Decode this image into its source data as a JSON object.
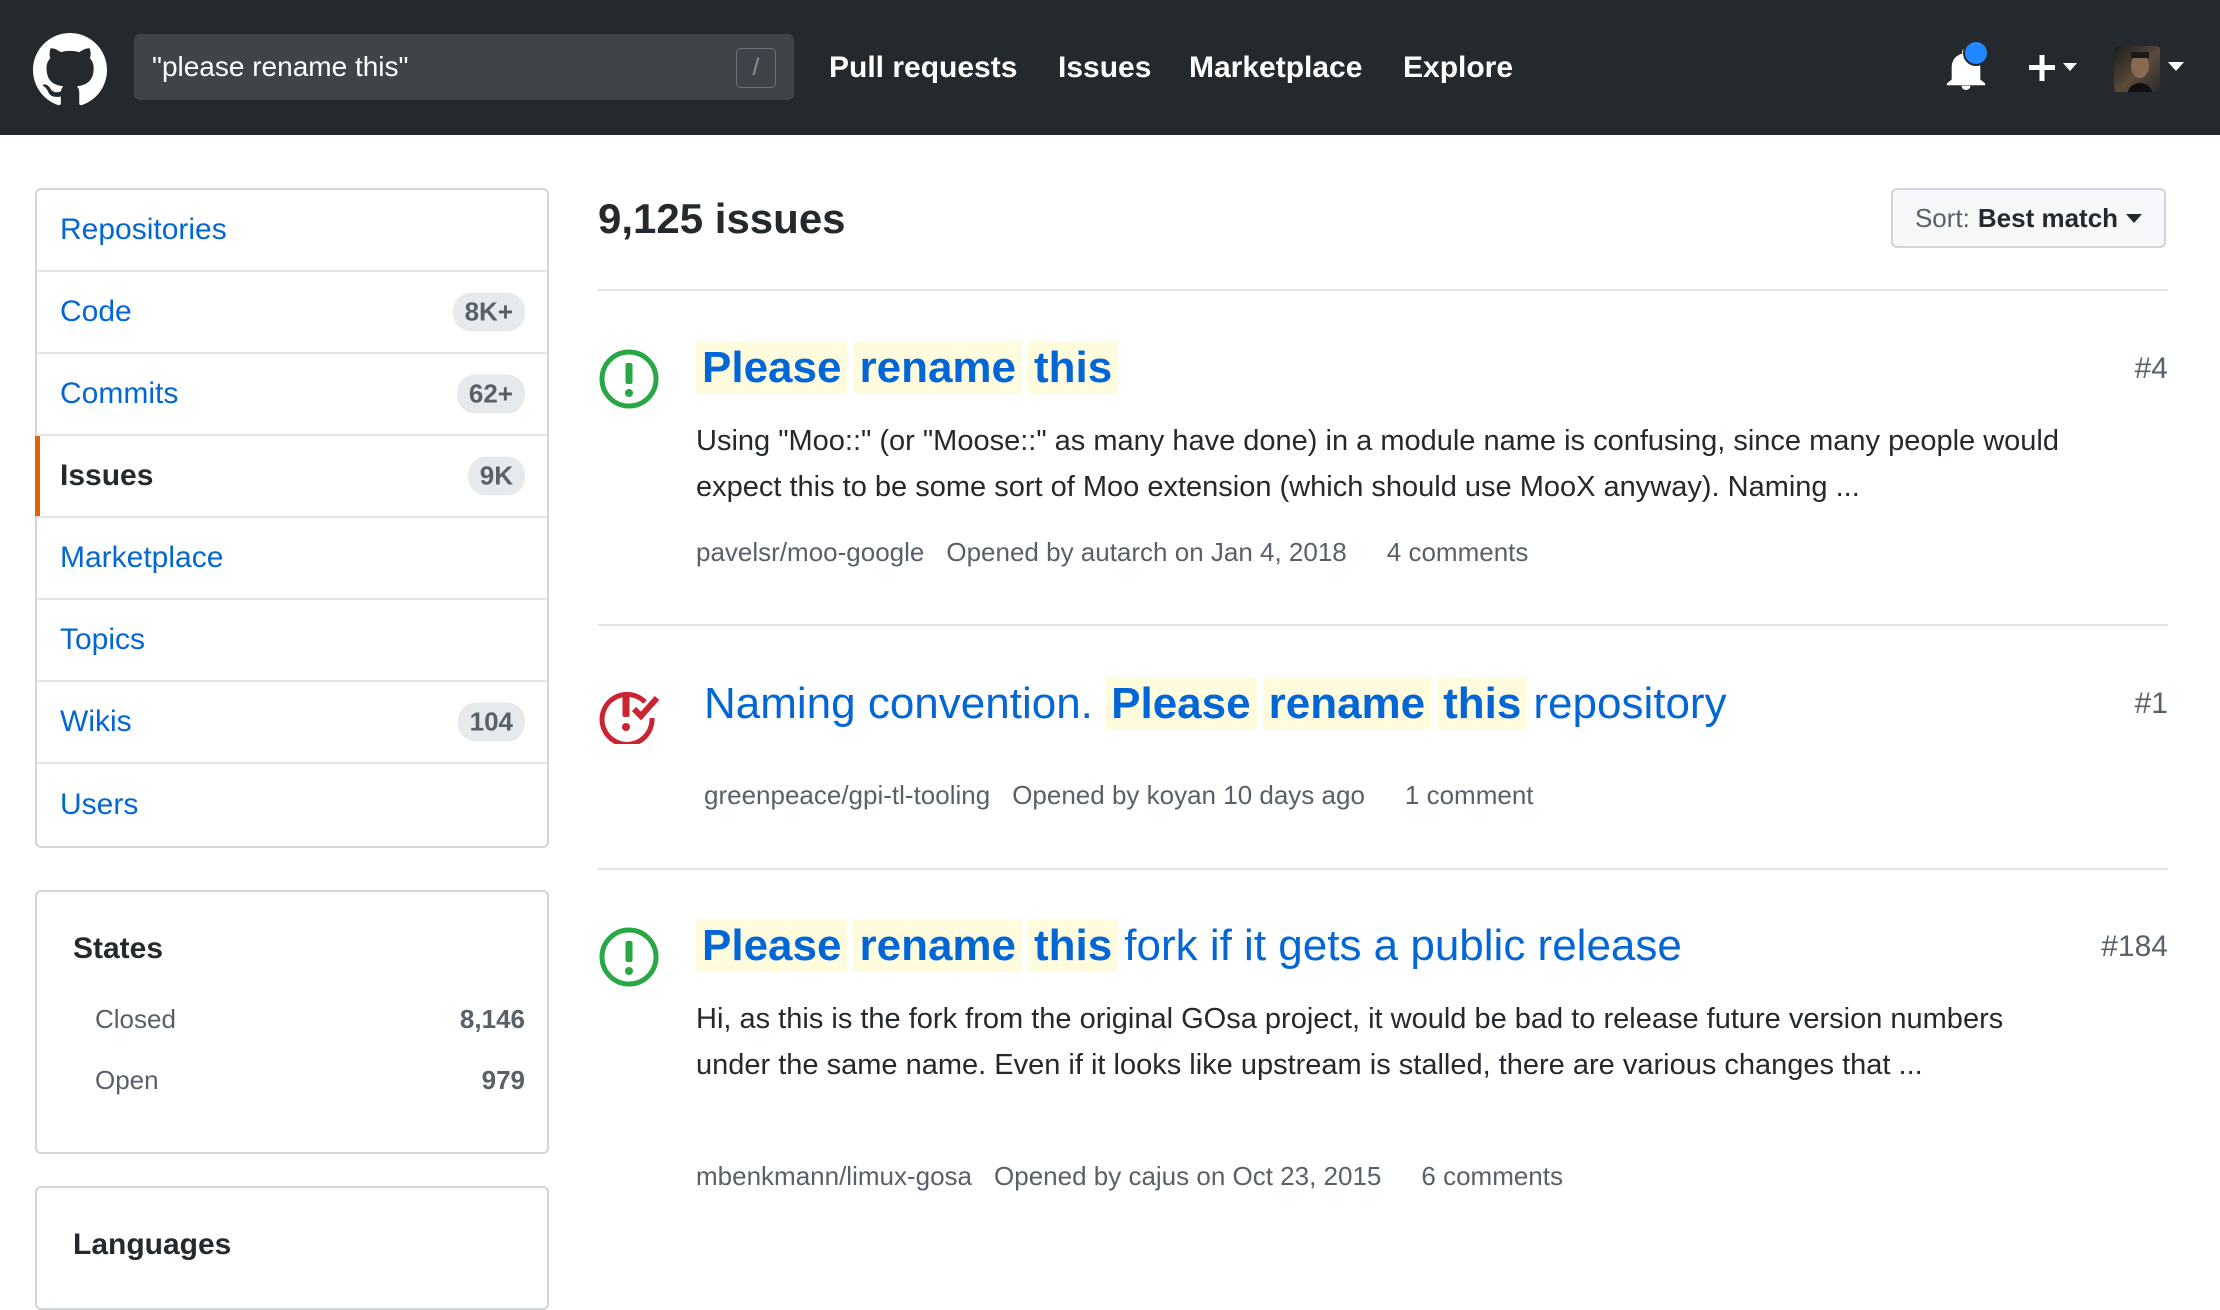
{
  "header": {
    "search_value": "\"please rename this\"",
    "search_shortcut": "/",
    "nav": [
      "Pull requests",
      "Issues",
      "Marketplace",
      "Explore"
    ],
    "icons": [
      "github-logo-icon",
      "bell-icon",
      "plus-icon",
      "avatar"
    ]
  },
  "sidebar": {
    "items": [
      {
        "label": "Repositories",
        "count": ""
      },
      {
        "label": "Code",
        "count": "8K+"
      },
      {
        "label": "Commits",
        "count": "62+"
      },
      {
        "label": "Issues",
        "count": "9K",
        "selected": true
      },
      {
        "label": "Marketplace",
        "count": ""
      },
      {
        "label": "Topics",
        "count": ""
      },
      {
        "label": "Wikis",
        "count": "104"
      },
      {
        "label": "Users",
        "count": ""
      }
    ],
    "states": {
      "title": "States",
      "rows": [
        {
          "label": "Closed",
          "count": "8,146"
        },
        {
          "label": "Open",
          "count": "979"
        }
      ]
    },
    "languages_title": "Languages"
  },
  "main": {
    "results_title": "9,125 issues",
    "sort_label": "Sort:",
    "sort_value": "Best match",
    "issues": [
      {
        "state": "open",
        "title_highlight": [
          "Please",
          "rename",
          "this"
        ],
        "title_rest": "",
        "number": "#4",
        "body": "Using \"Moo::\" (or \"Moose::\" as many have done) in a module name is confusing, since many people would expect this to be some sort of Moo extension (which should use MooX anyway). Naming ...",
        "repo": "pavelsr/moo-google",
        "opened": "Opened by autarch on Jan 4, 2018",
        "comments": "4 comments"
      },
      {
        "state": "closed",
        "title_prefix": "Naming convention.",
        "title_highlight": [
          "Please",
          "rename",
          "this"
        ],
        "title_rest": "repository",
        "number": "#1",
        "body": "",
        "repo": "greenpeace/gpi-tl-tooling",
        "opened": "Opened by koyan 10 days ago",
        "comments": "1 comment"
      },
      {
        "state": "open",
        "title_highlight": [
          "Please",
          "rename",
          "this"
        ],
        "title_rest": "fork if it gets a public release",
        "number": "#184",
        "body": "Hi, as this is the fork from the original GOsa project, it would be bad to release future version numbers under the same name. Even if it looks like upstream is stalled, there are various changes that ...",
        "repo": "mbenkmann/limux-gosa",
        "opened": "Opened by cajus on Oct 23, 2015",
        "comments": "6 comments"
      }
    ]
  },
  "colors": {
    "header_bg": "#24292e",
    "link": "#0366d6",
    "open_green": "#28a745",
    "closed_red": "#cb2431",
    "highlight": "#fffbdd",
    "selected_accent": "#e36209",
    "notification_dot": "#2188ff"
  }
}
